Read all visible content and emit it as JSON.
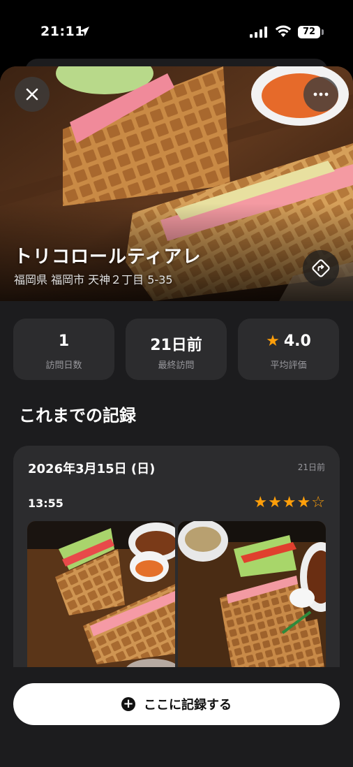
{
  "status_bar": {
    "time": "21:11",
    "battery": "72"
  },
  "place": {
    "name": "トリコロールティアレ",
    "address": "福岡県 福岡市 天神２丁目 5-35"
  },
  "icons": {
    "close": "close-icon",
    "more": "more-icon",
    "directions": "directions-icon",
    "star": "star-icon",
    "plus": "plus-icon"
  },
  "stats": [
    {
      "value": "1",
      "label": "訪問日数"
    },
    {
      "value": "21日前",
      "label": "最終訪問"
    },
    {
      "value": "4.0",
      "label": "平均評価"
    }
  ],
  "section_title": "これまでの記録",
  "record": {
    "date": "2026年3月15日 (日)",
    "ago": "21日前",
    "entry_time": "13:55",
    "rating": 4,
    "rating_max": 5
  },
  "action_button": {
    "label": "ここに記録する"
  },
  "colors": {
    "background": "#000000",
    "sheet": "#1c1c1e",
    "card": "#2c2c2e",
    "accent_star": "#ff9f0a",
    "secondary_text": "#98989d"
  }
}
